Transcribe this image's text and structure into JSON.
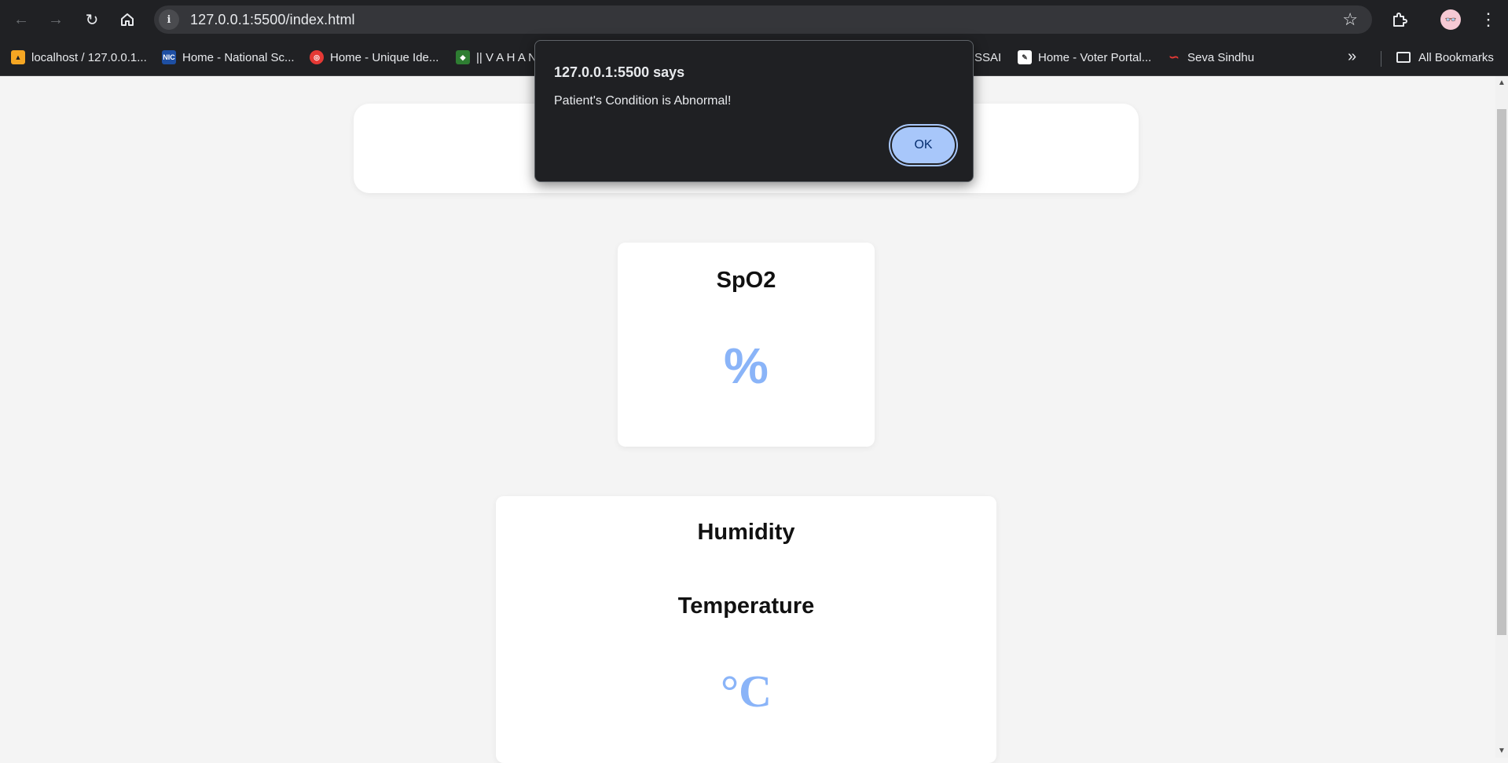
{
  "browser": {
    "url": "127.0.0.1:5500/index.html",
    "bookmarks": [
      {
        "label": "localhost / 127.0.0.1...",
        "icon": "pma-favicon"
      },
      {
        "label": "Home - National Sc...",
        "icon": "nic-favicon"
      },
      {
        "label": "Home - Unique Ide...",
        "icon": "uidai-favicon"
      },
      {
        "label": "|| V A H A N",
        "icon": "vahan-favicon"
      },
      {
        "label": "SSAI",
        "icon": "fssai-favicon"
      },
      {
        "label": "Home - Voter Portal...",
        "icon": "voter-favicon"
      },
      {
        "label": "Seva Sindhu",
        "icon": "seva-favicon"
      }
    ],
    "all_bookmarks_label": "All Bookmarks",
    "nic_favicon_text": "NIC"
  },
  "page": {
    "spo2": {
      "title": "SpO2",
      "unit": "%"
    },
    "humidity": {
      "title": "Humidity"
    },
    "temperature": {
      "title": "Temperature",
      "unit": "°C"
    }
  },
  "dialog": {
    "title": "127.0.0.1:5500 says",
    "message": "Patient's Condition is Abnormal!",
    "ok_label": "OK"
  },
  "colors": {
    "accent": "#8ab4f8",
    "dialog_button": "#a8c7fa",
    "chrome_bg": "#202124",
    "page_bg": "#f4f4f4"
  }
}
